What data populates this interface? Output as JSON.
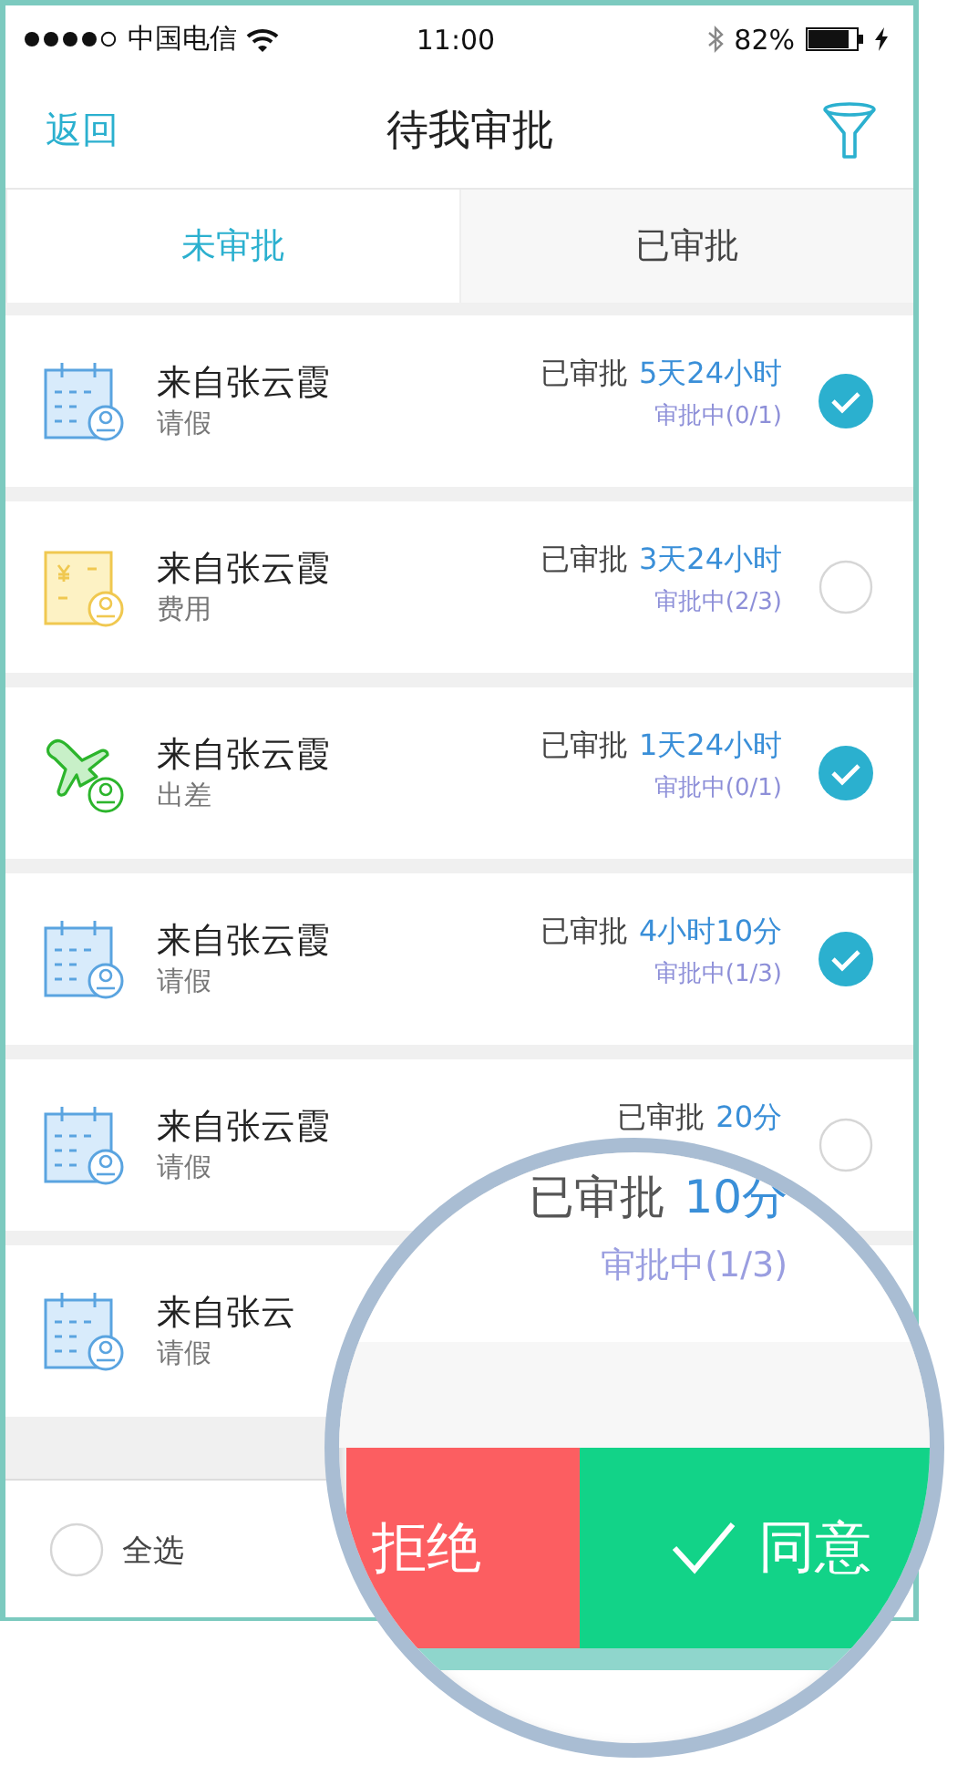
{
  "status_bar": {
    "carrier": "中国电信",
    "time": "11:00",
    "battery": "82%"
  },
  "nav": {
    "back": "返回",
    "title": "待我审批"
  },
  "tabs": [
    {
      "label": "未审批",
      "selected": true
    },
    {
      "label": "已审批",
      "selected": false
    }
  ],
  "items": [
    {
      "kind": "leave",
      "title": "来自张云霞",
      "type": "请假",
      "approved_label": "已审批",
      "duration": "5天24小时",
      "status": "审批中(0/1)",
      "checked": true
    },
    {
      "kind": "expense",
      "title": "来自张云霞",
      "type": "费用",
      "approved_label": "已审批",
      "duration": "3天24小时",
      "status": "审批中(2/3)",
      "checked": false
    },
    {
      "kind": "trip",
      "title": "来自张云霞",
      "type": "出差",
      "approved_label": "已审批",
      "duration": "1天24小时",
      "status": "审批中(0/1)",
      "checked": true
    },
    {
      "kind": "leave",
      "title": "来自张云霞",
      "type": "请假",
      "approved_label": "已审批",
      "duration": "4小时10分",
      "status": "审批中(1/3)",
      "checked": true
    },
    {
      "kind": "leave",
      "title": "来自张云霞",
      "type": "请假",
      "approved_label": "已审批",
      "duration": "20分",
      "checked": false
    },
    {
      "kind": "leave",
      "title": "来自张云",
      "type": "请假"
    }
  ],
  "bottom_bar": {
    "select_all": "全选",
    "checked": false
  },
  "magnifier": {
    "approved_label": "已审批",
    "duration": "10分",
    "status": "审批中(1/3)",
    "reject": "拒绝",
    "agree": "同意"
  }
}
